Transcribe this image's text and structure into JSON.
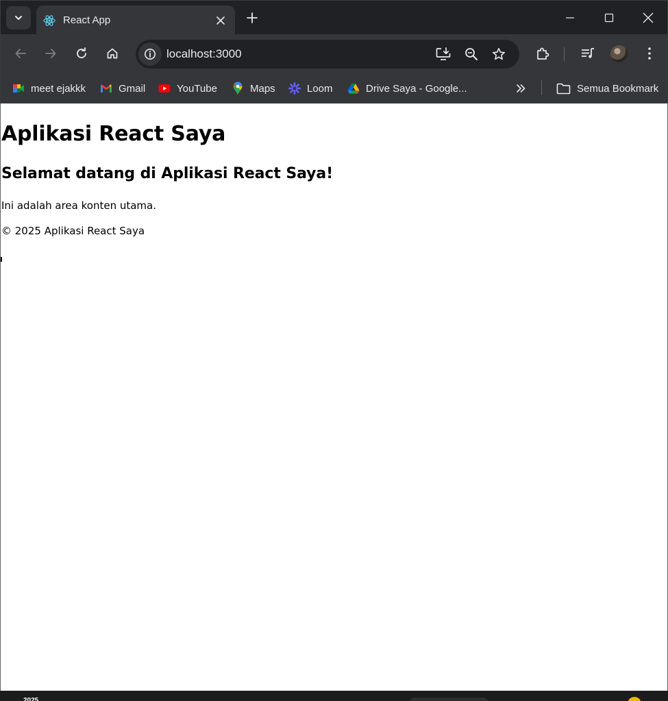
{
  "browser": {
    "tab": {
      "title": "React App",
      "favicon": "react-icon"
    },
    "address": {
      "url": "localhost:3000"
    },
    "icons": {
      "back": "arrow-left-icon",
      "forward": "arrow-right-icon",
      "reload": "reload-icon",
      "home": "home-icon",
      "site_info": "info-icon",
      "install": "install-app-icon",
      "zoom": "zoom-out-icon",
      "bookmark": "star-icon",
      "extensions": "puzzle-icon",
      "media": "media-queue-icon",
      "menu": "kebab-menu-icon"
    },
    "bookmarks": [
      {
        "label": "meet ejakkk",
        "icon": "google-meet-icon"
      },
      {
        "label": "Gmail",
        "icon": "gmail-icon"
      },
      {
        "label": "YouTube",
        "icon": "youtube-icon"
      },
      {
        "label": "Maps",
        "icon": "maps-icon"
      },
      {
        "label": "Loom",
        "icon": "loom-icon"
      },
      {
        "label": "Drive Saya - Google...",
        "icon": "google-drive-icon"
      }
    ],
    "all_bookmarks": {
      "label": "Semua Bookmark",
      "icon": "folder-icon"
    },
    "colors": {
      "frame": "#202124",
      "toolbar": "#35363a",
      "text": "#e8eaed",
      "icon": "#c4c7c5"
    }
  },
  "page": {
    "heading": "Aplikasi React Saya",
    "subheading": "Selamat datang di Aplikasi React Saya!",
    "main_text": "Ini adalah area konten utama.",
    "footer_text": "© 2025 Aplikasi React Saya"
  },
  "taskbar": {
    "partial_text": "2025"
  }
}
